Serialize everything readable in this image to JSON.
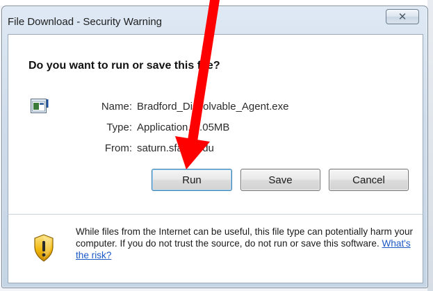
{
  "window": {
    "title": "File Download - Security Warning",
    "close_glyph": "✕"
  },
  "dialog": {
    "question": "Do you want to run or save this file?",
    "file": {
      "name_label": "Name:",
      "name_value": "Bradford_Dissolvable_Agent.exe",
      "type_label": "Type:",
      "type_value": "Application, 1.05MB",
      "from_label": "From:",
      "from_value": "saturn.sfasu.edu"
    },
    "buttons": {
      "run": "Run",
      "save": "Save",
      "cancel": "Cancel"
    }
  },
  "warning": {
    "text": "While files from the Internet can be useful, this file type can potentially harm your computer. If you do not trust the source, do not run or save this software.",
    "link": "What's the risk?"
  },
  "colors": {
    "annotation_arrow": "#ff0000",
    "link": "#1a58c5"
  }
}
